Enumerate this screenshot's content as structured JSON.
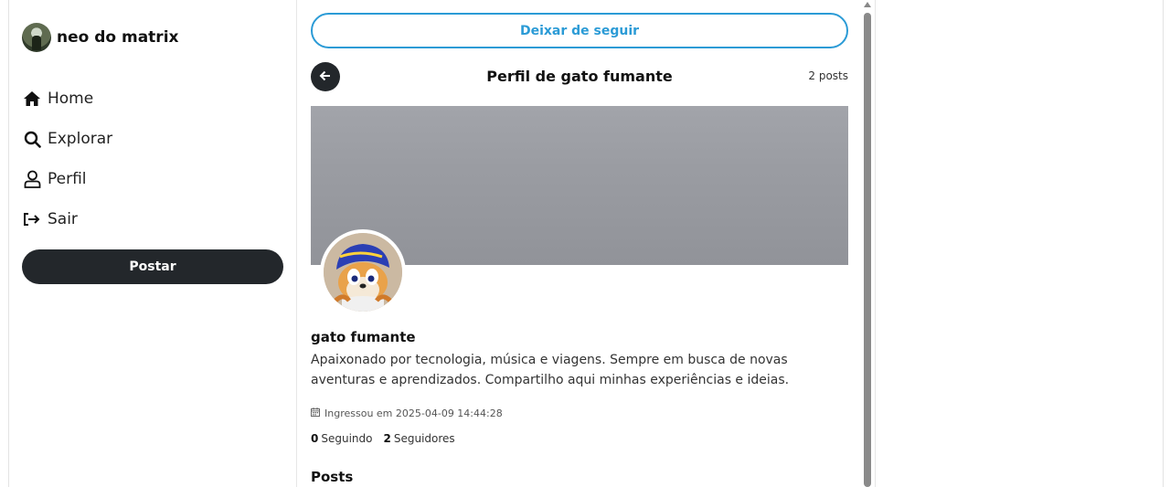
{
  "user": {
    "name": "neo do matrix",
    "avatar_icon": "user-avatar"
  },
  "sidebar": {
    "items": [
      {
        "label": "Home",
        "icon": "home-icon"
      },
      {
        "label": "Explorar",
        "icon": "search-icon"
      },
      {
        "label": "Perfil",
        "icon": "person-icon"
      },
      {
        "label": "Sair",
        "icon": "logout-icon"
      }
    ],
    "post_label": "Postar"
  },
  "main": {
    "unfollow_label": "Deixar de seguir",
    "title": "Perfil de gato fumante",
    "post_count": "2 posts",
    "profile": {
      "name": "gato fumante",
      "bio": "Apaixonado por tecnologia, música e viagens. Sempre em busca de novas aventuras e aprendizados. Compartilho aqui minhas experiências e ideias.",
      "joined": "Ingressou em 2025-04-09 14:44:28",
      "following_count": "0",
      "following_label": "Seguindo",
      "followers_count": "2",
      "followers_label": "Seguidores"
    },
    "posts_heading": "Posts"
  },
  "colors": {
    "accent": "#2b9bd6",
    "dark_button": "#23272b",
    "banner": "#9a9ca2"
  }
}
